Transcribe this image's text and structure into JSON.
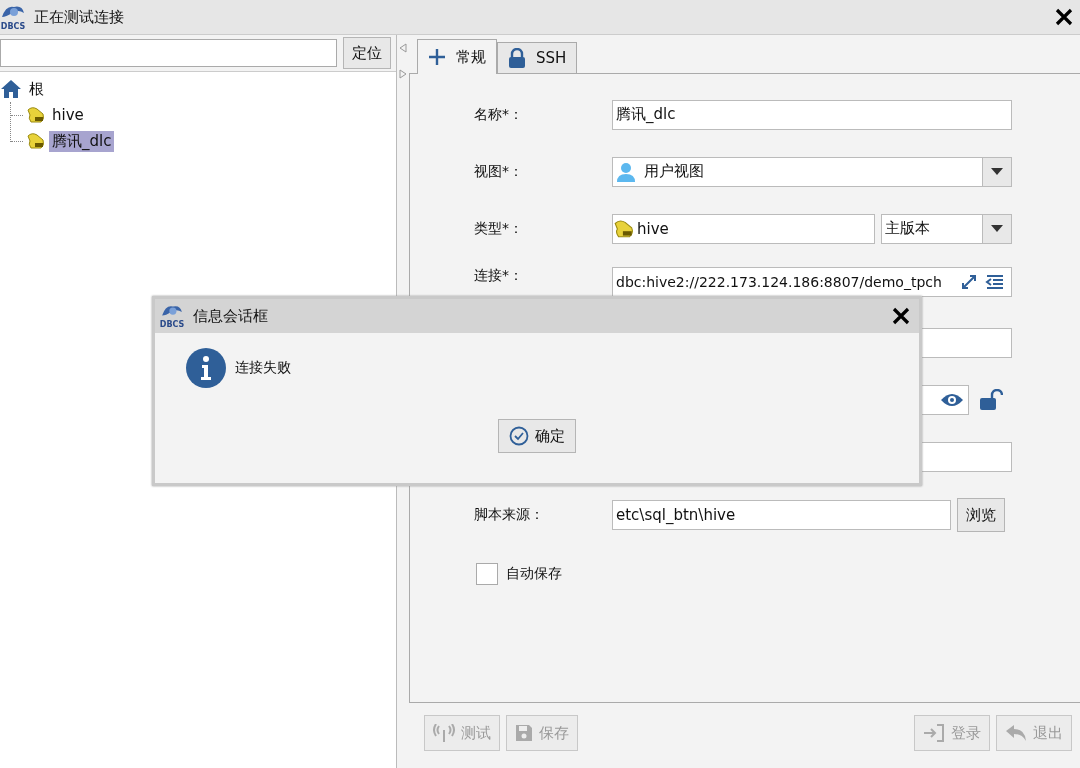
{
  "window": {
    "logo_text": "DBCS",
    "title": "正在测试连接"
  },
  "search": {
    "button": "定位"
  },
  "tree": [
    {
      "label": "根",
      "kind": "root",
      "selected": false,
      "children": [
        {
          "label": "hive",
          "kind": "db",
          "selected": false
        },
        {
          "label": "腾讯_dlc",
          "kind": "db",
          "selected": true
        }
      ]
    }
  ],
  "tabs": [
    {
      "label": "常规",
      "kind": "general",
      "selected": true
    },
    {
      "label": "SSH",
      "kind": "ssh",
      "selected": false
    }
  ],
  "form": [
    {
      "kind": "text",
      "label": "名称*：",
      "value": "腾讯_dlc"
    },
    {
      "kind": "combo",
      "label": "视图*：",
      "value": "用户视图"
    },
    {
      "kind": "type",
      "label": "类型*：",
      "value": "hive",
      "version": "主版本"
    },
    {
      "kind": "connection",
      "label": "连接*：",
      "value": "dbc:hive2://222.173.124.186:8807/demo_tpch"
    },
    {
      "kind": "blank"
    },
    {
      "kind": "password"
    },
    {
      "kind": "blank"
    },
    {
      "kind": "browse",
      "label": "脚本来源：",
      "value": "etc\\sql_btn\\hive",
      "button": "浏览"
    },
    {
      "kind": "checkbox",
      "label": "自动保存",
      "checked": false
    }
  ],
  "buttons": [
    {
      "label": "测试",
      "kind": "test",
      "disabled": true
    },
    {
      "label": "保存",
      "kind": "save",
      "disabled": true
    },
    {
      "label": "登录",
      "kind": "login",
      "disabled": true
    },
    {
      "label": "退出",
      "kind": "exit",
      "disabled": true
    }
  ],
  "dialog": {
    "logo_text": "DBCS",
    "title": "信息会话框",
    "message": "连接失败",
    "button": "确定"
  }
}
